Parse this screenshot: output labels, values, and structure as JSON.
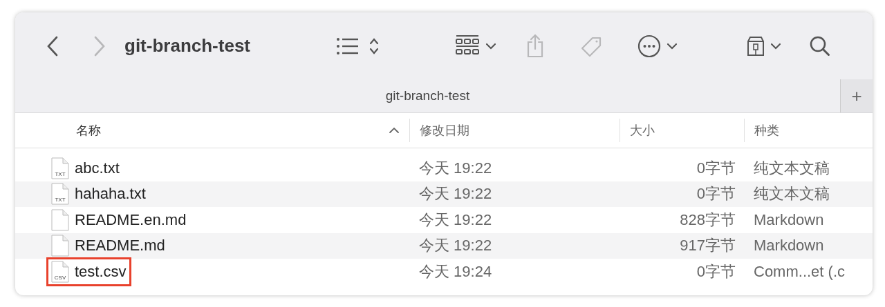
{
  "window": {
    "title": "git-branch-test"
  },
  "toolbar": {
    "back_disabled": false,
    "forward_disabled": true,
    "share_disabled": true,
    "tag_disabled": true
  },
  "tabs": [
    {
      "label": "git-branch-test",
      "selected": true
    }
  ],
  "new_tab_label": "+",
  "table": {
    "columns": [
      {
        "label": "名称",
        "sorted": true
      },
      {
        "label": "修改日期",
        "sorted": false
      },
      {
        "label": "大小",
        "sorted": false
      },
      {
        "label": "种类",
        "sorted": false
      }
    ],
    "rows": [
      {
        "icon_label": "TXT",
        "name": "abc.txt",
        "date": "今天 19:22",
        "size": "0字节",
        "kind": "纯文本文稿",
        "highlighted": false
      },
      {
        "icon_label": "TXT",
        "name": "hahaha.txt",
        "date": "今天 19:22",
        "size": "0字节",
        "kind": "纯文本文稿",
        "highlighted": false
      },
      {
        "name": "README.en.md",
        "date": "今天 19:22",
        "size": "828字节",
        "kind": "Markdown",
        "highlighted": false
      },
      {
        "name": "README.md",
        "date": "今天 19:22",
        "size": "917字节",
        "kind": "Markdown",
        "highlighted": false
      },
      {
        "icon_label": "CSV",
        "name": "test.csv",
        "date": "今天 19:24",
        "size": "0字节",
        "kind": "Comm...et (.c",
        "highlighted": true
      }
    ]
  }
}
